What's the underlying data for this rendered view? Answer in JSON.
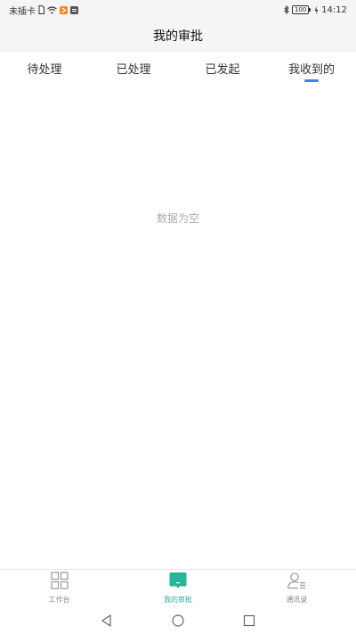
{
  "status_bar": {
    "carrier": "未插卡",
    "battery": "100",
    "time": "14:12"
  },
  "header": {
    "title": "我的审批"
  },
  "tabs": [
    {
      "label": "待处理",
      "active": false
    },
    {
      "label": "已处理",
      "active": false
    },
    {
      "label": "已发起",
      "active": false
    },
    {
      "label": "我收到的",
      "active": true
    }
  ],
  "empty_state": {
    "text": "数据为空"
  },
  "bottom_nav": [
    {
      "label": "工作台",
      "icon": "grid-icon",
      "active": false
    },
    {
      "label": "我的审批",
      "icon": "approval-icon",
      "active": true
    },
    {
      "label": "通讯录",
      "icon": "contacts-icon",
      "active": false
    }
  ],
  "colors": {
    "accent": "#24b59a",
    "tab_indicator": "#2d8cf0",
    "header_bg": "#f5f5f5"
  }
}
